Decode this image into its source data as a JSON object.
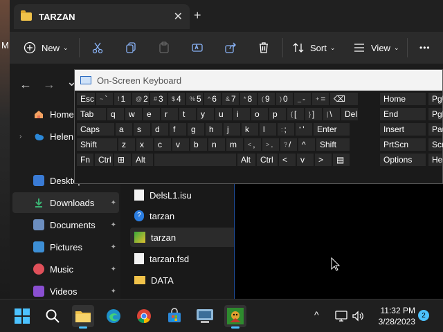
{
  "desktop": {
    "edge_letter": "M"
  },
  "explorer": {
    "tab_title": "TARZAN",
    "close_glyph": "✕",
    "new_tab_glyph": "+",
    "toolbar": {
      "new_label": "New",
      "sort_label": "Sort",
      "view_label": "View",
      "more_glyph": "•••"
    },
    "nav": {
      "back": "←",
      "forward": "→",
      "down": "⌄"
    },
    "sidebar": {
      "items": [
        {
          "label": "Home"
        },
        {
          "label": "Helen -"
        },
        {
          "label": "Desktop"
        },
        {
          "label": "Downloads"
        },
        {
          "label": "Documents"
        },
        {
          "label": "Pictures"
        },
        {
          "label": "Music"
        },
        {
          "label": "Videos"
        }
      ],
      "pin_glyph": "📌"
    },
    "files": [
      {
        "name": "DelsL1.isu"
      },
      {
        "name": "tarzan"
      },
      {
        "name": "tarzan"
      },
      {
        "name": "tarzan.fsd"
      },
      {
        "name": "DATA"
      }
    ]
  },
  "osk": {
    "title": "On-Screen Keyboard",
    "row1": [
      {
        "main": "Esc"
      },
      {
        "main": "`",
        "shift": "~"
      },
      {
        "main": "1",
        "shift": "!"
      },
      {
        "main": "2",
        "shift": "@"
      },
      {
        "main": "3",
        "shift": "#"
      },
      {
        "main": "4",
        "shift": "$"
      },
      {
        "main": "5",
        "shift": "%"
      },
      {
        "main": "6",
        "shift": "^"
      },
      {
        "main": "7",
        "shift": "&"
      },
      {
        "main": "8",
        "shift": "*"
      },
      {
        "main": "9",
        "shift": "("
      },
      {
        "main": "0",
        "shift": ")"
      },
      {
        "main": "-",
        "shift": "_"
      },
      {
        "main": "=",
        "shift": "+"
      },
      {
        "main": "⌫"
      }
    ],
    "row2": [
      {
        "main": "Tab"
      },
      {
        "main": "q"
      },
      {
        "main": "w"
      },
      {
        "main": "e"
      },
      {
        "main": "r"
      },
      {
        "main": "t"
      },
      {
        "main": "y"
      },
      {
        "main": "u"
      },
      {
        "main": "i"
      },
      {
        "main": "o"
      },
      {
        "main": "p"
      },
      {
        "main": "[",
        "shift": "{"
      },
      {
        "main": "]",
        "shift": "}"
      },
      {
        "main": "\\",
        "shift": "|"
      },
      {
        "main": "Del"
      }
    ],
    "row3": [
      {
        "main": "Caps"
      },
      {
        "main": "a"
      },
      {
        "main": "s"
      },
      {
        "main": "d"
      },
      {
        "main": "f"
      },
      {
        "main": "g"
      },
      {
        "main": "h"
      },
      {
        "main": "j"
      },
      {
        "main": "k"
      },
      {
        "main": "l"
      },
      {
        "main": ";",
        "shift": ":"
      },
      {
        "main": "'",
        "shift": "\""
      },
      {
        "main": "Enter"
      }
    ],
    "row4": [
      {
        "main": "Shift"
      },
      {
        "main": "z"
      },
      {
        "main": "x"
      },
      {
        "main": "c"
      },
      {
        "main": "v"
      },
      {
        "main": "b"
      },
      {
        "main": "n"
      },
      {
        "main": "m"
      },
      {
        "main": ",",
        "shift": "<"
      },
      {
        "main": ".",
        "shift": ">"
      },
      {
        "main": "/",
        "shift": "?"
      },
      {
        "main": "^"
      },
      {
        "main": "Shift"
      }
    ],
    "row5": [
      {
        "main": "Fn"
      },
      {
        "main": "Ctrl"
      },
      {
        "main": "⊞"
      },
      {
        "main": "Alt"
      },
      {
        "main": ""
      },
      {
        "main": "Alt"
      },
      {
        "main": "Ctrl"
      },
      {
        "main": "<"
      },
      {
        "main": "v"
      },
      {
        "main": ">"
      },
      {
        "main": "▤"
      }
    ],
    "side": [
      [
        "Home",
        "PgU"
      ],
      [
        "End",
        "PgD"
      ],
      [
        "Insert",
        "Paus"
      ],
      [
        "PrtScn",
        "ScrL"
      ],
      [
        "Options",
        "Help"
      ]
    ]
  },
  "taskbar": {
    "time": "11:32 PM",
    "date": "3/28/2023",
    "notification_count": "2",
    "tray_up": "^"
  }
}
